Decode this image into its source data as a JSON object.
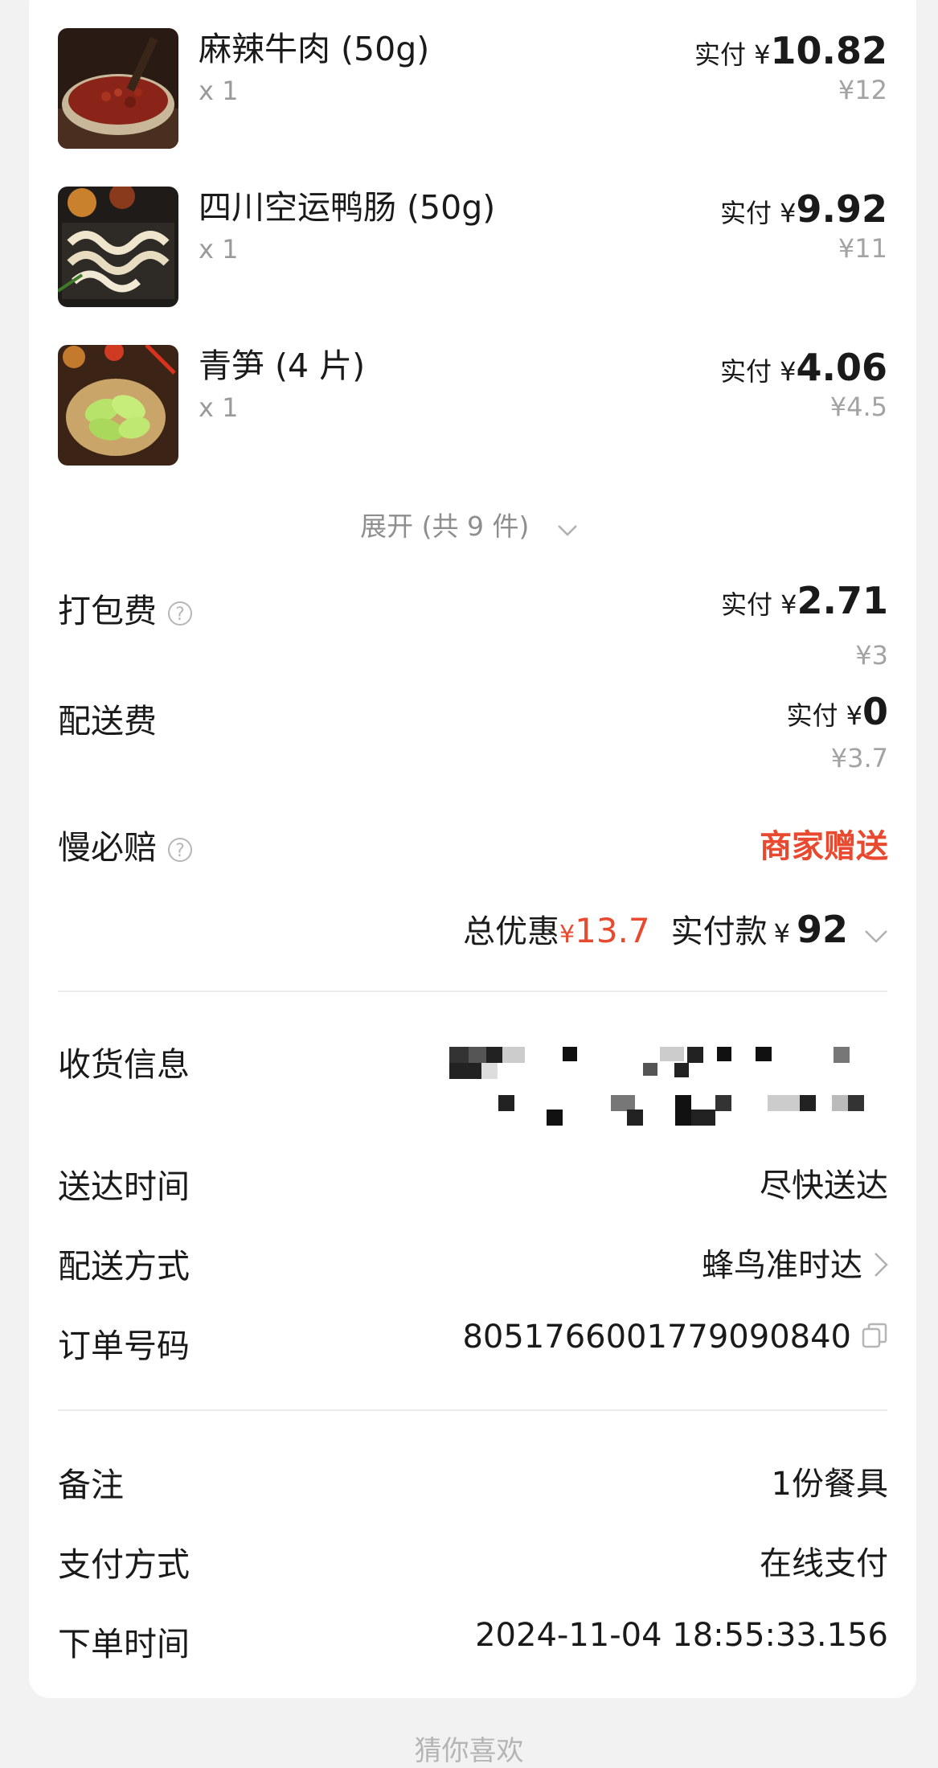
{
  "items": [
    {
      "name": "麻辣牛肉 (50g)",
      "qty": "x 1",
      "pay_prefix": "实付 ¥",
      "pay_amount": "10.82",
      "original": "¥12",
      "thumb_icon": "spicy-beef-photo"
    },
    {
      "name": "四川空运鸭肠 (50g)",
      "qty": "x 1",
      "pay_prefix": "实付 ¥",
      "pay_amount": "9.92",
      "original": "¥11",
      "thumb_icon": "duck-intestine-photo"
    },
    {
      "name": "青笋 (4 片)",
      "qty": "x 1",
      "pay_prefix": "实付 ¥",
      "pay_amount": "4.06",
      "original": "¥4.5",
      "thumb_icon": "lettuce-stem-photo"
    }
  ],
  "expand_label": "展开 (共 9 件)",
  "fees": {
    "packing": {
      "label": "打包费",
      "pay_prefix": "实付 ¥",
      "pay_amount": "2.71",
      "original": "¥3"
    },
    "delivery": {
      "label": "配送费",
      "pay_prefix": "实付 ¥",
      "pay_amount": "0",
      "original": "¥3.7"
    },
    "slow_guarantee": {
      "label": "慢必赔",
      "value": "商家赠送"
    }
  },
  "summary": {
    "discount_label": "总优惠",
    "discount_currency": "¥",
    "discount_amount": "13.7",
    "paid_label": "实付款",
    "paid_currency": "¥",
    "paid_amount": "92"
  },
  "info": {
    "receiver_label": "收货信息",
    "delivery_time_label": "送达时间",
    "delivery_time_value": "尽快送达",
    "delivery_method_label": "配送方式",
    "delivery_method_value": "蜂鸟准时达",
    "order_no_label": "订单号码",
    "order_no_value": "8051766001779090840"
  },
  "extra": {
    "note_label": "备注",
    "note_value": "1份餐具",
    "payment_label": "支付方式",
    "payment_value": "在线支付",
    "order_time_label": "下单时间",
    "order_time_value": "2024-11-04 18:55:33.156"
  },
  "footer_hint": "猜你喜欢",
  "colors": {
    "accent_red": "#e8492f",
    "text": "#1a1a1a",
    "muted": "#9a9a9a",
    "background": "#f2f2f2"
  }
}
